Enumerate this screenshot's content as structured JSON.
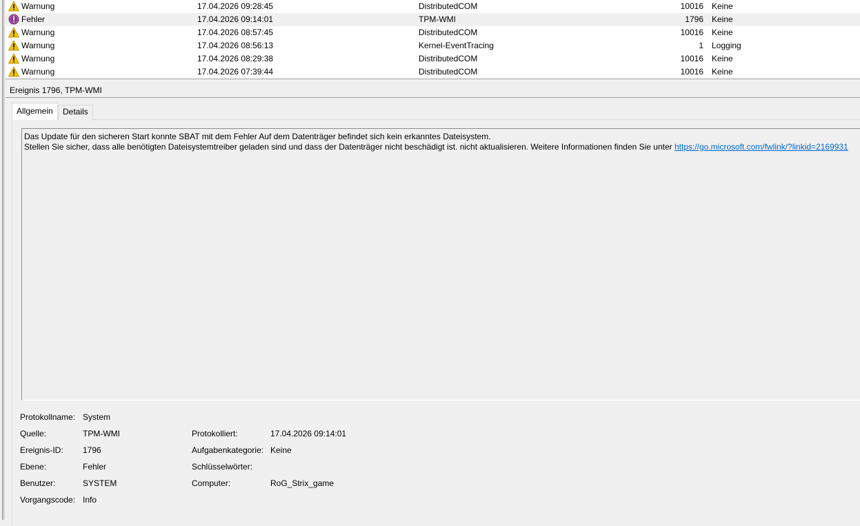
{
  "events": [
    {
      "level": "Warnung",
      "icon": "warning-icon",
      "date": "17.04.2026 09:28:45",
      "source": "DistributedCOM",
      "id": "10016",
      "category": "Keine",
      "selected": false
    },
    {
      "level": "Fehler",
      "icon": "error-icon",
      "date": "17.04.2026 09:14:01",
      "source": "TPM-WMI",
      "id": "1796",
      "category": "Keine",
      "selected": true
    },
    {
      "level": "Warnung",
      "icon": "warning-icon",
      "date": "17.04.2026 08:57:45",
      "source": "DistributedCOM",
      "id": "10016",
      "category": "Keine",
      "selected": false
    },
    {
      "level": "Warnung",
      "icon": "warning-icon",
      "date": "17.04.2026 08:56:13",
      "source": "Kernel-EventTracing",
      "id": "1",
      "category": "Logging",
      "selected": false
    },
    {
      "level": "Warnung",
      "icon": "warning-icon",
      "date": "17.04.2026 08:29:38",
      "source": "DistributedCOM",
      "id": "10016",
      "category": "Keine",
      "selected": false
    },
    {
      "level": "Warnung",
      "icon": "warning-icon",
      "date": "17.04.2026 07:39:44",
      "source": "DistributedCOM",
      "id": "10016",
      "category": "Keine",
      "selected": false
    }
  ],
  "details": {
    "title": "Ereignis 1796, TPM-WMI",
    "tabs": {
      "general": "Allgemein",
      "details": "Details"
    },
    "description_line1": "Das Update für den sicheren Start konnte SBAT mit dem Fehler Auf dem Datenträger befindet sich kein erkanntes Dateisystem.",
    "description_line2": "Stellen Sie sicher, dass alle benötigten Dateisystemtreiber geladen sind und dass der Datenträger nicht beschädigt ist. nicht aktualisieren. Weitere Informationen finden Sie unter ",
    "description_link": "https://go.microsoft.com/fwlink/?linkid=2169931",
    "props": {
      "log_name_label": "Protokollname:",
      "log_name": "System",
      "source_label": "Quelle:",
      "source": "TPM-WMI",
      "logged_label": "Protokolliert:",
      "logged": "17.04.2026 09:14:01",
      "event_id_label": "Ereignis-ID:",
      "event_id": "1796",
      "task_category_label": "Aufgabenkategorie:",
      "task_category": "Keine",
      "level_label": "Ebene:",
      "level": "Fehler",
      "keywords_label": "Schlüsselwörter:",
      "keywords": "",
      "user_label": "Benutzer:",
      "user": "SYSTEM",
      "computer_label": "Computer:",
      "computer": "RoG_Strix_game",
      "opcode_label": "Vorgangscode:",
      "opcode": "Info"
    }
  },
  "colors": {
    "warning": "#f2c200",
    "error": "#8b3a8f",
    "link": "#0066cc"
  }
}
